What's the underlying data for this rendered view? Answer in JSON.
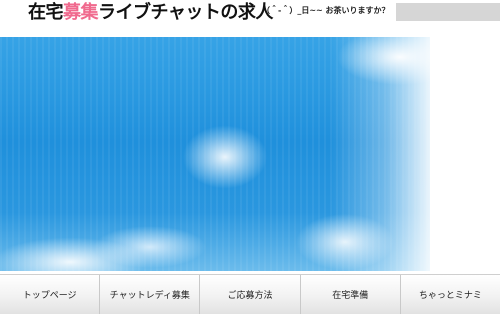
{
  "header": {
    "title_part1": "在宅",
    "title_accent": "募集",
    "title_part2": "ライブチャットの求人",
    "tagline": "（＾-＾）_日~~ お茶いりますか？",
    "search_placeholder": ""
  },
  "nav": {
    "items": [
      {
        "label": "トップページ"
      },
      {
        "label": "チャットレディ募集"
      },
      {
        "label": "ご応募方法"
      },
      {
        "label": "在宅準備"
      },
      {
        "label": "ちゃっとミナミ"
      }
    ]
  },
  "colors": {
    "accent": "#f06a8e",
    "sky": "#1f90dc"
  }
}
